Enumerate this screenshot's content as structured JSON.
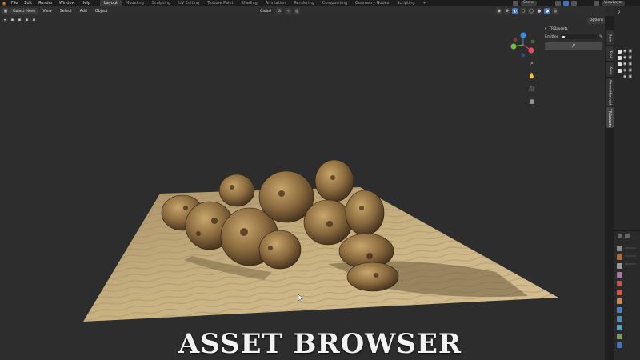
{
  "menu_bar": {
    "logo": "blender-logo",
    "items": [
      "File",
      "Edit",
      "Render",
      "Window",
      "Help"
    ],
    "workspaces": [
      "Layout",
      "Modeling",
      "Sculpting",
      "UV Editing",
      "Texture Paint",
      "Shading",
      "Animation",
      "Rendering",
      "Compositing",
      "Geometry Nodes",
      "Scripting",
      "+"
    ],
    "active_workspace": "Layout",
    "scene_label": "Scene",
    "view_layer_label": "ViewLayer"
  },
  "viewport_header": {
    "mode": "Object Mode",
    "menus": [
      "View",
      "Select",
      "Add",
      "Object"
    ],
    "orientation": "Global"
  },
  "options_label": "Options",
  "panel": {
    "title": "TRBassets",
    "emitter_label": "Emitter",
    "action_button": "//"
  },
  "side_tabs": [
    "Item",
    "Tool",
    "View",
    "AmmoHarvest",
    "TRBassets"
  ],
  "active_tab": "TRBassets",
  "colors": {
    "accent": "#4772b3",
    "gizmo_x": "#e74c5b",
    "gizmo_y": "#6fbf3a",
    "gizmo_z": "#3b8fe7",
    "sand": "#c7b07e",
    "rock": "#8a6a3e"
  },
  "overlay_title": "ASSET BROWSER"
}
